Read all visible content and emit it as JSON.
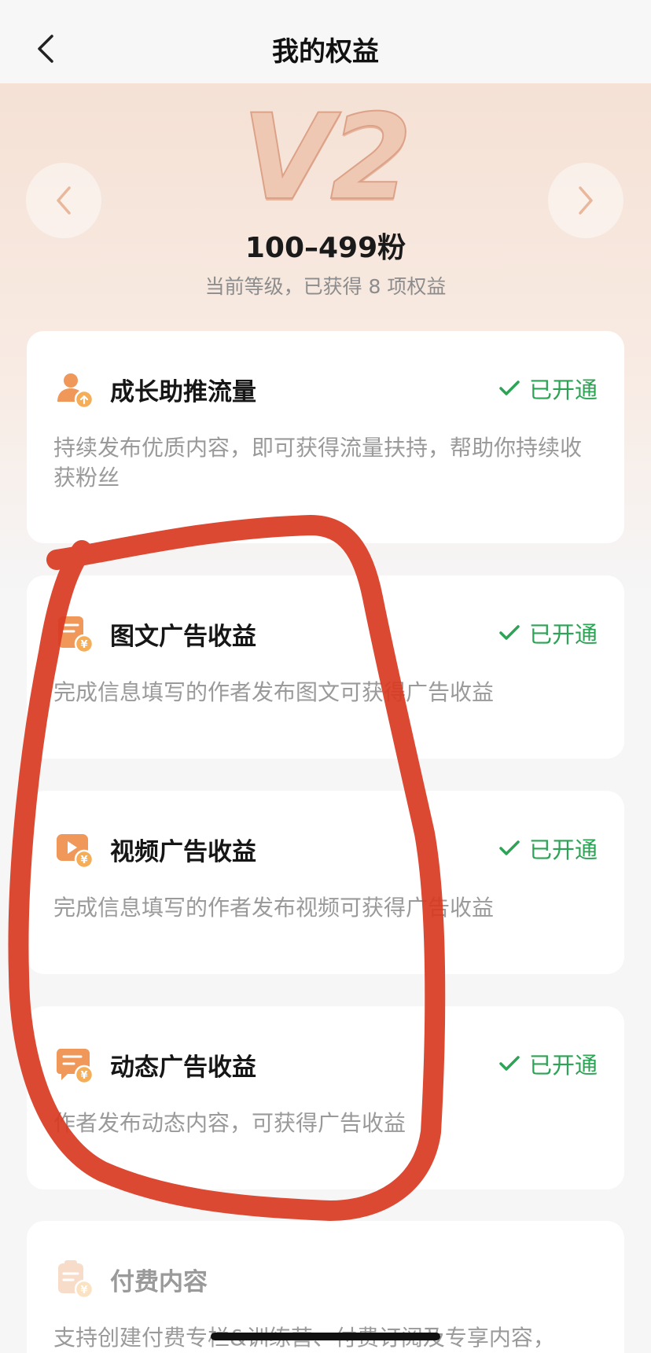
{
  "header": {
    "title": "我的权益"
  },
  "level": {
    "badge": "V2",
    "fans_range": "100–499粉",
    "description": "当前等级，已获得 8 项权益"
  },
  "benefits": [
    {
      "title": "成长助推流量",
      "status": "已开通",
      "description": "持续发布优质内容，即可获得流量扶持，帮助你持续收获粉丝",
      "icon": "growth-boost-icon"
    },
    {
      "title": "图文广告收益",
      "status": "已开通",
      "description": "完成信息填写的作者发布图文可获得广告收益",
      "icon": "article-ad-revenue-icon"
    },
    {
      "title": "视频广告收益",
      "status": "已开通",
      "description": "完成信息填写的作者发布视频可获得广告收益",
      "icon": "video-ad-revenue-icon"
    },
    {
      "title": "动态广告收益",
      "status": "已开通",
      "description": "作者发布动态内容，可获得广告收益",
      "icon": "post-ad-revenue-icon"
    },
    {
      "title": "付费内容",
      "status": "",
      "description": "支持创建付费专栏&训练营、付费订阅及专享内容，",
      "icon": "paid-content-icon"
    }
  ],
  "colors": {
    "accent_orange": "#f0975a",
    "status_green": "#2da355",
    "annotation_red": "#d93a22"
  }
}
